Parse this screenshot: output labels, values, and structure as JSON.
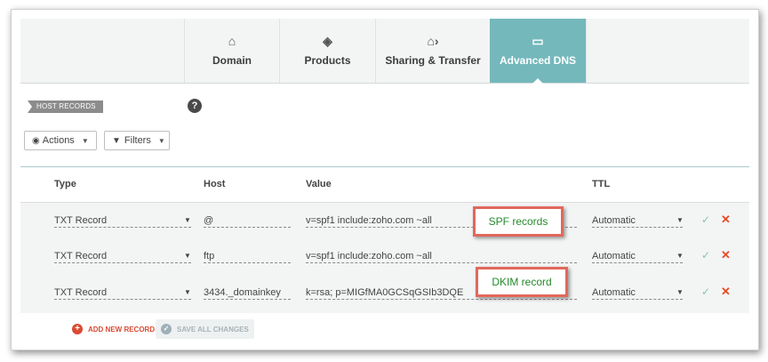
{
  "tabs": [
    {
      "label": "Domain",
      "icon": "house-icon",
      "glyph": "⌂"
    },
    {
      "label": "Products",
      "icon": "box-icon",
      "glyph": "◈"
    },
    {
      "label": "Sharing & Transfer",
      "icon": "share-house-icon",
      "glyph": "⌂"
    },
    {
      "label": "Advanced DNS",
      "icon": "dns-server-icon",
      "glyph": "▭"
    }
  ],
  "section": {
    "label": "HOST RECORDS",
    "help": "?"
  },
  "toolbar": {
    "actions_label": "Actions",
    "filters_label": "Filters"
  },
  "columns": {
    "type": "Type",
    "host": "Host",
    "value": "Value",
    "ttl": "TTL"
  },
  "records": [
    {
      "type": "TXT Record",
      "host": "@",
      "value": "v=spf1 include:zoho.com ~all",
      "ttl": "Automatic"
    },
    {
      "type": "TXT Record",
      "host": "ftp",
      "value": "v=spf1 include:zoho.com ~all",
      "ttl": "Automatic"
    },
    {
      "type": "TXT Record",
      "host": "3434._domainkey",
      "value": "k=rsa; p=MIGfMA0GCSqGSIb3DQE",
      "ttl": "Automatic"
    }
  ],
  "footer": {
    "add_label": "ADD NEW RECORD",
    "save_label": "SAVE ALL CHANGES"
  },
  "callouts": {
    "spf": "SPF records",
    "dkim": "DKIM record"
  },
  "colors": {
    "accent": "#74b8bc",
    "delete": "#e84a24",
    "confirm": "#8bc3a9",
    "callout_border": "#e2685c",
    "callout_text": "#248a2b"
  }
}
